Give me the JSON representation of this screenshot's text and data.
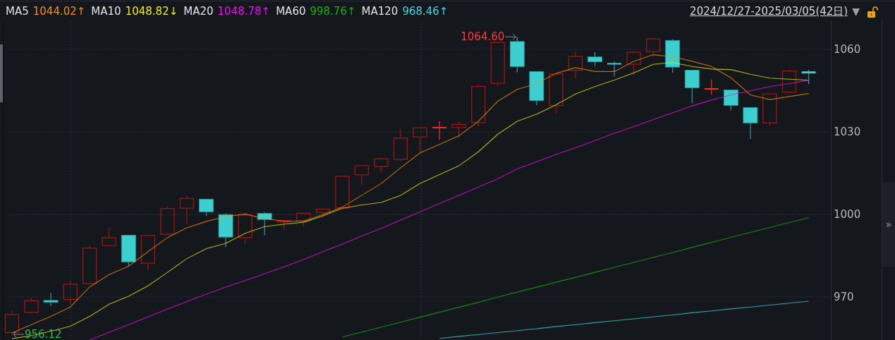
{
  "legend": [
    {
      "value": "1044.02↑"
    },
    {
      "value": "1048.82↓"
    },
    {
      "value": "1048.78↑"
    },
    {
      "value": "998.76↑"
    },
    {
      "value": "968.46↑"
    }
  ],
  "date_range": {
    "text": "2024/12/27-2025/03/05(42日)",
    "dropdown": "▼"
  },
  "lock": {
    "locked": false
  },
  "chart": {
    "chart_data": {
      "type": "line",
      "ylim": [
        954.4,
        1070.3
      ],
      "yticks": [
        970,
        1000,
        1030,
        1060
      ],
      "grid": true,
      "series": [
        {
          "name": "MA5",
          "color": "#f5900c",
          "values": [
            957,
            960,
            963,
            966.4,
            973.7,
            978.2,
            981.2,
            986.5,
            991.6,
            995.2,
            997.5,
            999.2,
            1000.2,
            998.5,
            997.6,
            997.6,
            1000,
            1002.7,
            1007,
            1011.3,
            1017,
            1022.4,
            1025.5,
            1028.6,
            1033.9,
            1041.2,
            1045.5,
            1047.6,
            1051.3,
            1053.4,
            1052,
            1052,
            1055.7,
            1058.1,
            1057.4,
            1055.7,
            1053.8,
            1049.7,
            1043.5,
            1041.8,
            1042.9,
            1044.0
          ]
        },
        {
          "name": "MA10",
          "color": "#eeee00",
          "values": [
            954.9,
            956,
            957.6,
            959.4,
            963,
            967.4,
            970.3,
            974.1,
            979,
            984,
            987.6,
            989.5,
            993.2,
            995.6,
            996.5,
            997.2,
            999.5,
            1002.3,
            1003.5,
            1004.4,
            1007,
            1011.3,
            1014.5,
            1017.7,
            1022.8,
            1029.2,
            1033.9,
            1036.5,
            1039.9,
            1043.8,
            1046.5,
            1048.9,
            1051.5,
            1054.6,
            1055.3,
            1053.8,
            1052.9,
            1052.7,
            1051,
            1049.6,
            1049.2,
            1048.8
          ]
        },
        {
          "name": "MA20",
          "color": "#f010f0",
          "values": [
            null,
            null,
            null,
            null,
            954.4,
            957.2,
            960,
            962.8,
            965.6,
            968.4,
            971.1,
            973.6,
            976,
            978.5,
            981,
            983.6,
            986.5,
            989.3,
            992.2,
            995,
            998,
            1001,
            1004,
            1007,
            1010,
            1013,
            1016.6,
            1019.2,
            1021.8,
            1024.3,
            1026.9,
            1029.5,
            1032,
            1034.5,
            1037,
            1039.5,
            1041.6,
            1043.5,
            1045,
            1046.5,
            1047.6,
            1048.8
          ]
        },
        {
          "name": "MA60",
          "color": "#18b018",
          "values": [
            null,
            null,
            null,
            null,
            null,
            null,
            null,
            null,
            null,
            null,
            null,
            null,
            null,
            null,
            null,
            null,
            null,
            955.5,
            957.3,
            959.1,
            960.9,
            962.7,
            964.5,
            966.3,
            968.1,
            970,
            971.8,
            973.6,
            975.4,
            977.2,
            979,
            980.8,
            982.6,
            984.4,
            986.2,
            988.1,
            989.9,
            991.7,
            993.5,
            995.3,
            997.1,
            998.8
          ]
        },
        {
          "name": "MA120",
          "color": "#40d8e0",
          "values": [
            null,
            null,
            null,
            null,
            null,
            null,
            null,
            null,
            null,
            null,
            null,
            null,
            null,
            null,
            null,
            null,
            null,
            null,
            null,
            null,
            null,
            null,
            955,
            955.7,
            956.4,
            957.1,
            957.8,
            958.5,
            959.3,
            960,
            960.7,
            961.4,
            962.1,
            962.8,
            963.5,
            964.3,
            965,
            965.7,
            966.4,
            967.1,
            967.8,
            968.5
          ]
        }
      ],
      "annotations": [
        "1064.60",
        "956.12"
      ]
    }
  },
  "collapse_handle": {
    "text": "»"
  }
}
